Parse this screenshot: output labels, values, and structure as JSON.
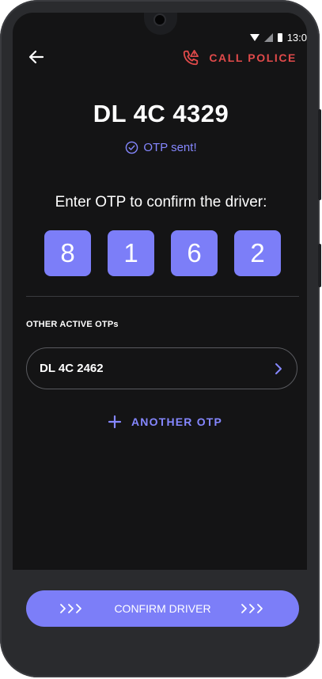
{
  "status_bar": {
    "time": "13:0"
  },
  "header": {
    "call_police_label": "CALL POLICE"
  },
  "vehicle": {
    "plate": "DL 4C 4329"
  },
  "otp_status": "OTP sent!",
  "prompt": "Enter OTP to confirm the driver:",
  "otp_digits": [
    "8",
    "1",
    "6",
    "2"
  ],
  "other_otps": {
    "section_title": "OTHER ACTIVE  OTPs",
    "items": [
      {
        "plate": "DL 4C 2462"
      }
    ]
  },
  "add_otp_label": "ANOTHER OTP",
  "confirm_button_label": "CONFIRM DRIVER",
  "colors": {
    "accent": "#7c7ef8",
    "danger": "#e04a4a",
    "background": "#141415"
  }
}
